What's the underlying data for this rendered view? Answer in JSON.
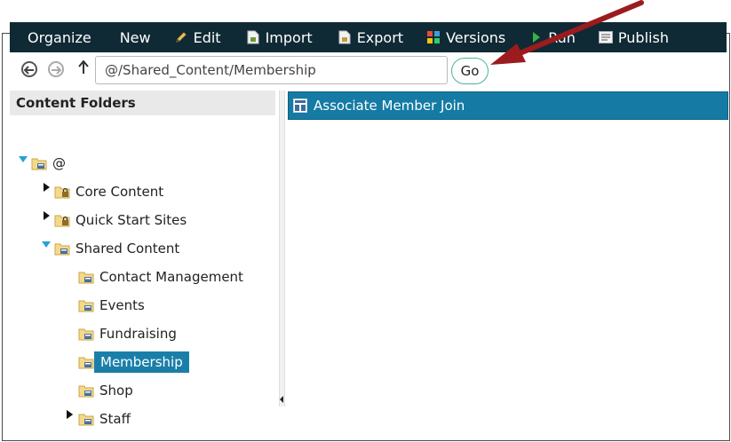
{
  "toolbar": {
    "organize": "Organize",
    "new": "New",
    "edit": "Edit",
    "import": "Import",
    "export": "Export",
    "versions": "Versions",
    "run": "Run",
    "publish": "Publish"
  },
  "nav": {
    "path": "@/Shared_Content/Membership",
    "go_label": "Go"
  },
  "left_panel": {
    "title": "Content Folders",
    "tree": {
      "root": "@",
      "core_content": "Core Content",
      "quick_start_sites": "Quick Start Sites",
      "shared_content": "Shared Content",
      "contact_management": "Contact Management",
      "events": "Events",
      "fundraising": "Fundraising",
      "membership": "Membership",
      "shop": "Shop",
      "staff": "Staff"
    }
  },
  "right_panel": {
    "items": [
      "Associate Member Join"
    ]
  },
  "colors": {
    "toolbar_bg": "#0f2a35",
    "selection": "#1a7fa8",
    "annotation_arrow": "#9b1b1f"
  },
  "icons": {
    "edit": "pencil-icon",
    "import": "import-file-icon",
    "export": "export-file-icon",
    "versions": "versions-grid-icon",
    "run": "play-icon",
    "publish": "publish-icon",
    "back": "back-arrow-icon",
    "forward": "forward-arrow-icon",
    "up": "up-arrow-icon",
    "folder": "folder-icon",
    "locked_folder": "locked-folder-icon",
    "content_item": "content-item-icon"
  }
}
